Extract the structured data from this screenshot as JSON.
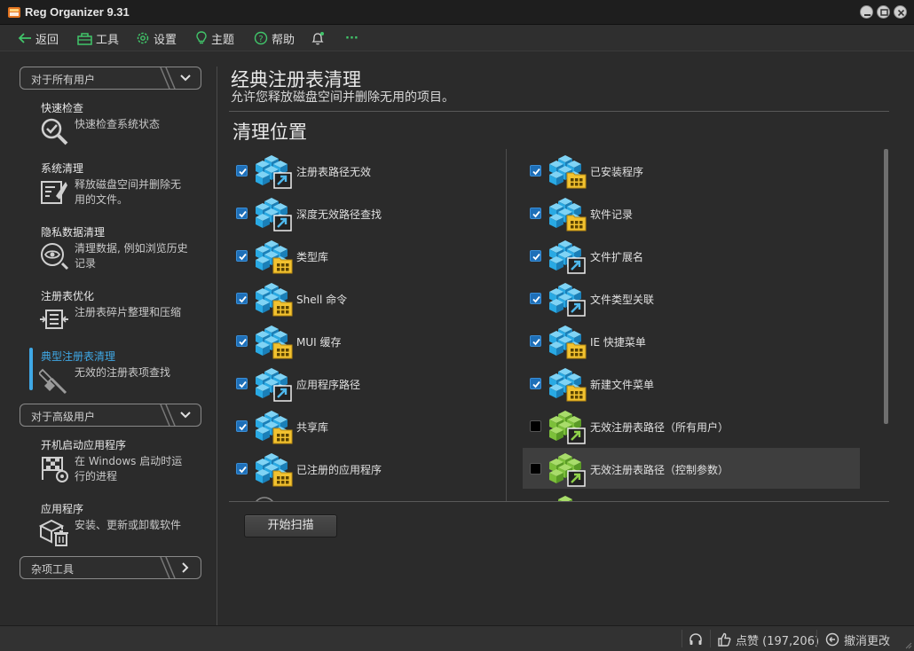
{
  "window": {
    "title": "Reg Organizer 9.31"
  },
  "toolbar": {
    "back": "返回",
    "tools": "工具",
    "settings": "设置",
    "theme": "主题",
    "help": "帮助",
    "more": "···"
  },
  "sidebar": {
    "groups": {
      "all_users": "对于所有用户",
      "advanced": "对于高级用户",
      "misc": "杂项工具"
    },
    "items": [
      {
        "title": "快速检查",
        "desc": "快速检查系统状态"
      },
      {
        "title": "系统清理",
        "desc": "释放磁盘空间并删除无用的文件。"
      },
      {
        "title": "隐私数据清理",
        "desc": "清理数据, 例如浏览历史记录"
      },
      {
        "title": "注册表优化",
        "desc": "注册表碎片整理和压缩"
      },
      {
        "title": "典型注册表清理",
        "desc": "无效的注册表项查找"
      },
      {
        "title": "开机启动应用程序",
        "desc": "在 Windows 启动时运行的进程"
      },
      {
        "title": "应用程序",
        "desc": "安装、更新或卸载软件"
      }
    ]
  },
  "main": {
    "title": "经典注册表清理",
    "subtitle": "允许您释放磁盘空间并删除无用的项目。",
    "section_title": "清理位置",
    "left_items": [
      {
        "label": "注册表路径无效",
        "checked": true,
        "badge": "arrow",
        "color": "blue"
      },
      {
        "label": "深度无效路径查找",
        "checked": true,
        "badge": "arrow",
        "color": "blue"
      },
      {
        "label": "类型库",
        "checked": true,
        "badge": "grid",
        "color": "blue"
      },
      {
        "label": "Shell 命令",
        "checked": true,
        "badge": "grid",
        "color": "blue"
      },
      {
        "label": "MUI 缓存",
        "checked": true,
        "badge": "grid",
        "color": "blue"
      },
      {
        "label": "应用程序路径",
        "checked": true,
        "badge": "arrow",
        "color": "blue"
      },
      {
        "label": "共享库",
        "checked": true,
        "badge": "grid",
        "color": "blue"
      },
      {
        "label": "已注册的应用程序",
        "checked": true,
        "badge": "grid",
        "color": "blue"
      }
    ],
    "right_items": [
      {
        "label": "已安装程序",
        "checked": true,
        "badge": "grid",
        "color": "blue"
      },
      {
        "label": "软件记录",
        "checked": true,
        "badge": "grid",
        "color": "blue"
      },
      {
        "label": "文件扩展名",
        "checked": true,
        "badge": "arrow",
        "color": "blue"
      },
      {
        "label": "文件类型关联",
        "checked": true,
        "badge": "arrow",
        "color": "blue"
      },
      {
        "label": "IE 快捷菜单",
        "checked": true,
        "badge": "grid",
        "color": "blue"
      },
      {
        "label": "新建文件菜单",
        "checked": true,
        "badge": "grid",
        "color": "blue"
      },
      {
        "label": "无效注册表路径（所有用户）",
        "checked": false,
        "badge": "arrow",
        "color": "green"
      },
      {
        "label": "无效注册表路径（控制参数）",
        "checked": false,
        "badge": "arrow",
        "color": "green"
      }
    ],
    "scan_button": "开始扫描"
  },
  "statusbar": {
    "likes": "点赞 (197,206)",
    "undo": "撤消更改"
  },
  "colors": {
    "accent": "#3fa8e6",
    "cube_blue": "#29a9e3",
    "cube_green": "#7cc03a",
    "folder": "#f2c230"
  }
}
